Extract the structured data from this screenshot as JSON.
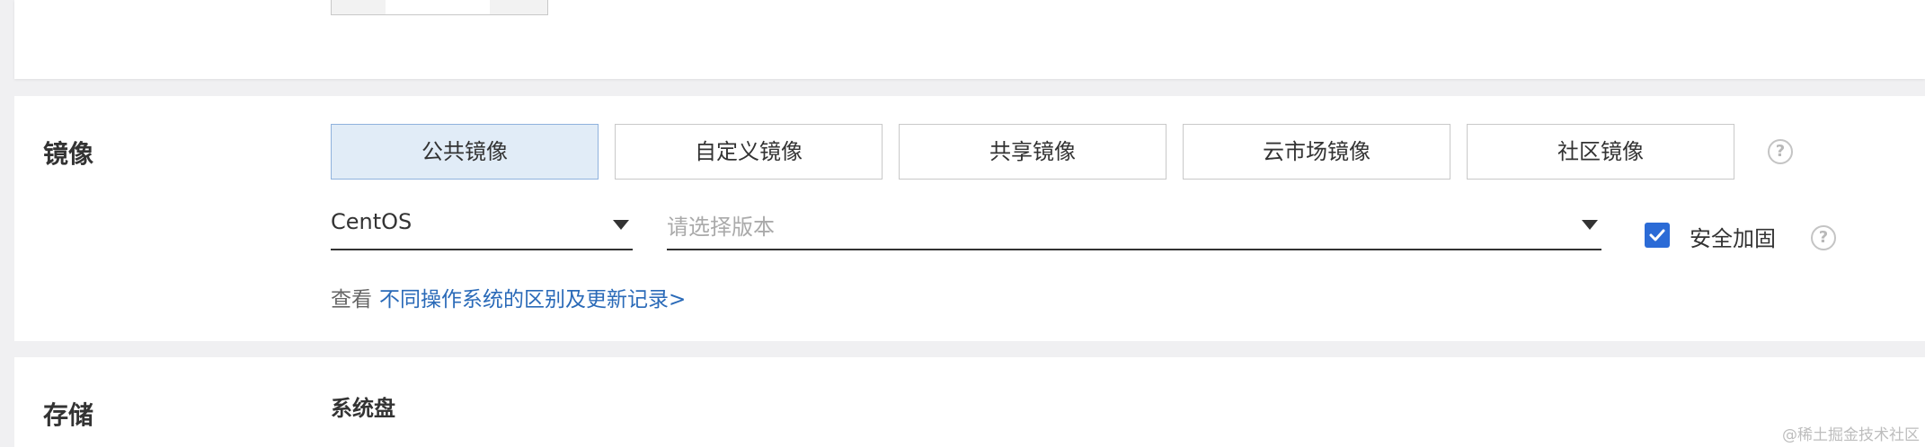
{
  "image_section": {
    "label": "镜像",
    "tabs": [
      {
        "label": "公共镜像",
        "active": true
      },
      {
        "label": "自定义镜像",
        "active": false
      },
      {
        "label": "共享镜像",
        "active": false
      },
      {
        "label": "云市场镜像",
        "active": false
      },
      {
        "label": "社区镜像",
        "active": false
      }
    ],
    "os_select": {
      "value": "CentOS"
    },
    "version_select": {
      "placeholder": "请选择版本"
    },
    "security_hardening": {
      "label": "安全加固",
      "checked": true
    },
    "note_prefix": "查看",
    "note_link": "不同操作系统的区别及更新记录>"
  },
  "storage_section": {
    "label": "存储",
    "sub_label": "系统盘"
  },
  "watermark": "@稀土掘金技术社区",
  "colors": {
    "active_tab_bg": "#e1ecf7",
    "active_tab_border": "#8fb2dd",
    "checkbox": "#2b6bd6",
    "link": "#2a6ab8"
  }
}
